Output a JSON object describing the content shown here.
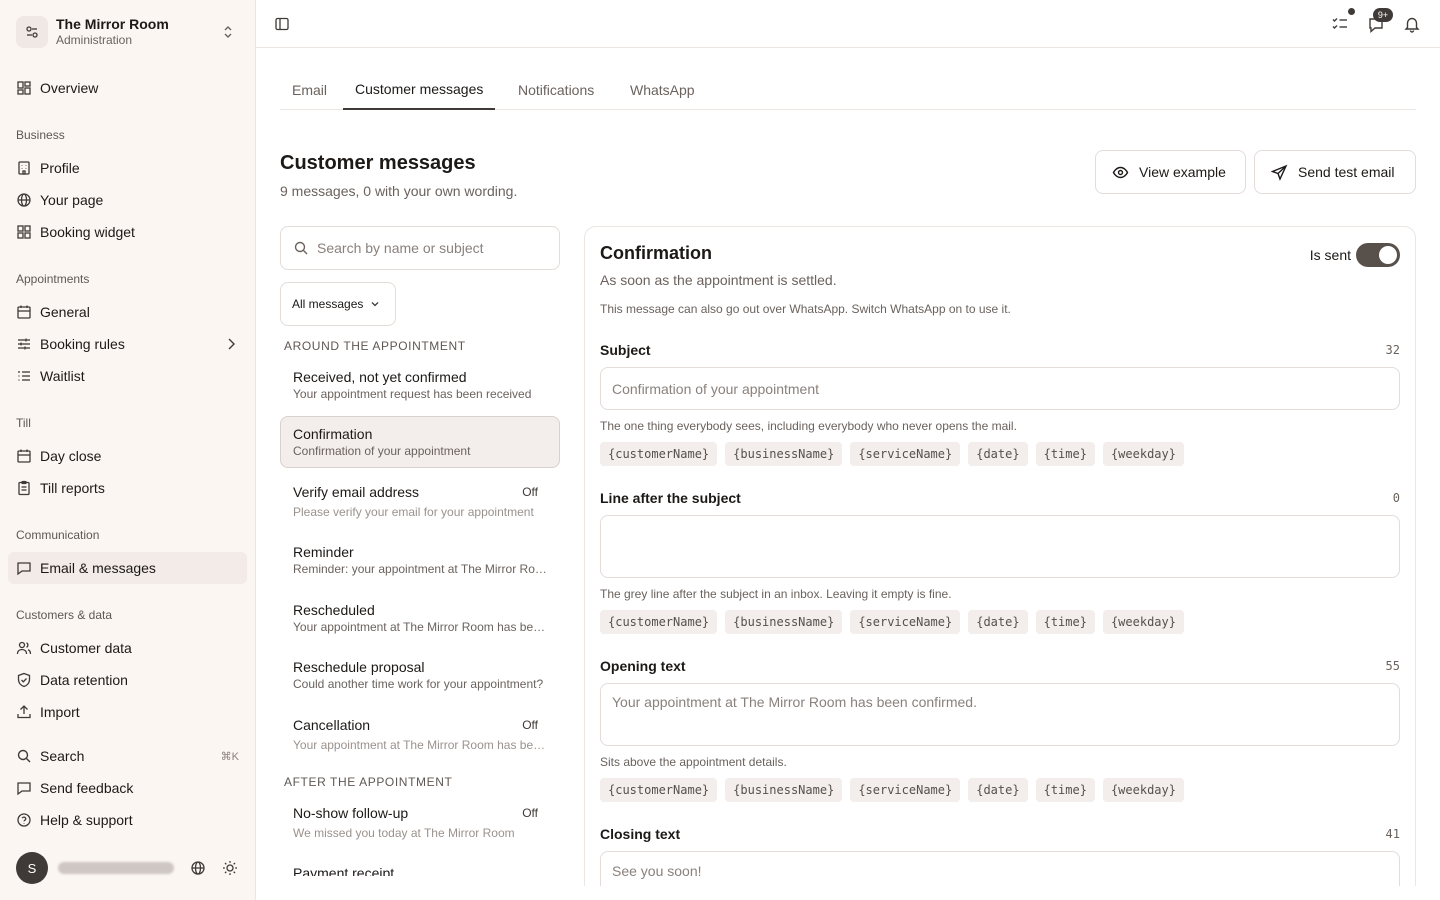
{
  "workspace": {
    "name": "The Mirror Room",
    "subtitle": "Administration"
  },
  "sidebar": {
    "overview": "Overview",
    "sections": {
      "business": "Business",
      "appointments": "Appointments",
      "till": "Till",
      "communication": "Communication",
      "customers": "Customers & data"
    },
    "business_items": [
      "Profile",
      "Your page",
      "Booking widget"
    ],
    "appointment_items": [
      "General",
      "Booking rules",
      "Waitlist"
    ],
    "till_items": [
      "Day close",
      "Till reports"
    ],
    "communication_items": [
      "Email & messages"
    ],
    "customer_items": [
      "Customer data",
      "Data retention",
      "Import"
    ],
    "bottom_items": [
      "Search",
      "Send feedback",
      "Help & support"
    ],
    "search_shortcut": "⌘K",
    "active": "Email & messages"
  },
  "user": {
    "initial": "S"
  },
  "topbar": {
    "notification_badge": "9+"
  },
  "tabs": [
    "Email",
    "Customer messages",
    "Notifications",
    "WhatsApp"
  ],
  "active_tab": "Customer messages",
  "header": {
    "title": "Customer messages",
    "subtitle": "9 messages, 0 with your own wording.",
    "view_example": "View example",
    "send_test": "Send test email"
  },
  "list": {
    "search_placeholder": "Search by name or subject",
    "filter_label": "All messages",
    "group_around": "AROUND THE APPOINTMENT",
    "group_after": "AFTER THE APPOINTMENT",
    "off_label": "Off",
    "items": [
      {
        "title": "Received, not yet confirmed",
        "subject": "Your appointment request has been received",
        "off": false
      },
      {
        "title": "Confirmation",
        "subject": "Confirmation of your appointment",
        "off": false,
        "selected": true
      },
      {
        "title": "Verify email address",
        "subject": "Please verify your email for your appointment",
        "off": true
      },
      {
        "title": "Reminder",
        "subject": "Reminder: your appointment at The Mirror Room",
        "off": false
      },
      {
        "title": "Rescheduled",
        "subject": "Your appointment at The Mirror Room has been rescheduled",
        "off": false
      },
      {
        "title": "Reschedule proposal",
        "subject": "Could another time work for your appointment?",
        "off": false
      },
      {
        "title": "Cancellation",
        "subject": "Your appointment at The Mirror Room has been cancelled",
        "off": true
      },
      {
        "title": "No-show follow-up",
        "subject": "We missed you today at The Mirror Room",
        "off": true
      },
      {
        "title": "Payment receipt",
        "subject": "",
        "off": false
      }
    ]
  },
  "detail": {
    "title": "Confirmation",
    "subtitle": "As soon as the appointment is settled.",
    "note": "This message can also go out over WhatsApp. Switch WhatsApp on to use it.",
    "toggle_label": "Is sent",
    "toggle_on": true,
    "variables": [
      "{customerName}",
      "{businessName}",
      "{serviceName}",
      "{date}",
      "{time}",
      "{weekday}"
    ],
    "fields": {
      "subject": {
        "label": "Subject",
        "count": "32",
        "placeholder": "Confirmation of your appointment",
        "help": "The one thing everybody sees, including everybody who never opens the mail."
      },
      "preheader": {
        "label": "Line after the subject",
        "count": "0",
        "placeholder": "",
        "help": "The grey line after the subject in an inbox. Leaving it empty is fine."
      },
      "opening": {
        "label": "Opening text",
        "count": "55",
        "placeholder": "Your appointment at The Mirror Room has been confirmed.",
        "help": "Sits above the appointment details."
      },
      "closing": {
        "label": "Closing text",
        "count": "41",
        "placeholder": "See you soon!"
      }
    }
  },
  "colors": {
    "sidebar_bg": "#fcf6f3",
    "accent": "#3f3a37",
    "chip_bg": "#f3eeeb"
  }
}
